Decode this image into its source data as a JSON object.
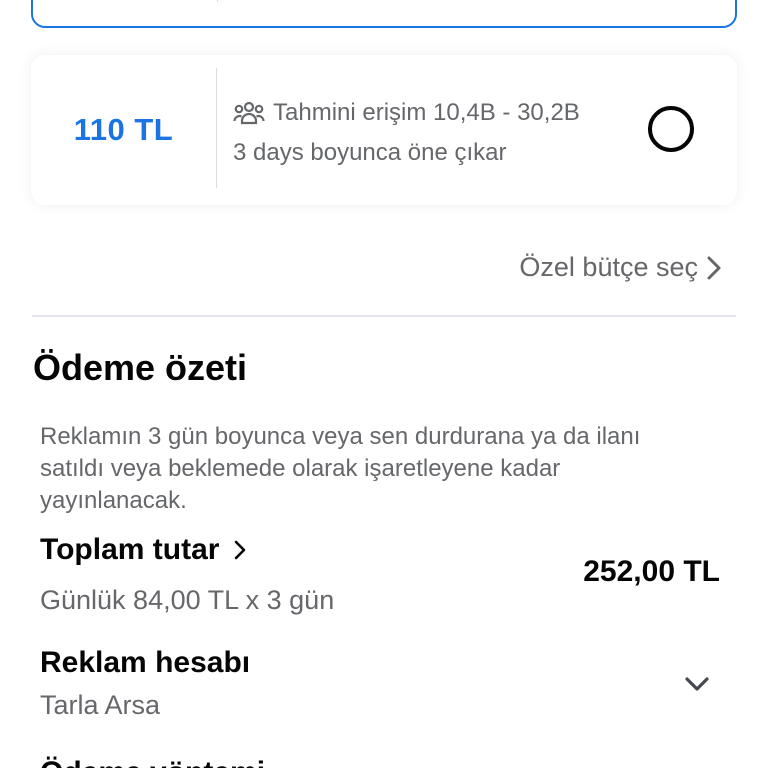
{
  "budget_options": {
    "option": {
      "price": "110 TL",
      "reach_text": "Tahmini erişim 10,4B - 30,2B",
      "duration_text": "3 days boyunca öne çıkar",
      "reach_icon": "people-group-icon",
      "selected": false
    }
  },
  "custom_budget": {
    "label": "Özel bütçe seç",
    "icon": "chevron-right-icon"
  },
  "payment_summary": {
    "title": "Ödeme özeti",
    "description": "Reklamın 3 gün boyunca veya sen durdurana ya da ilanı satıldı veya beklemede olarak işaretleyene kadar yayınlanacak.",
    "total": {
      "label": "Toplam tutar",
      "detail": "Günlük 84,00 TL x 3 gün",
      "amount": "252,00 TL"
    },
    "ad_account": {
      "label": "Reklam hesabı",
      "value": "Tarla Arsa"
    },
    "next_section_title": "Ödeme yöntemi"
  },
  "colors": {
    "accent": "#1b74e4",
    "text_primary": "#050505",
    "text_secondary": "#65676b",
    "divider": "#dadde1"
  }
}
